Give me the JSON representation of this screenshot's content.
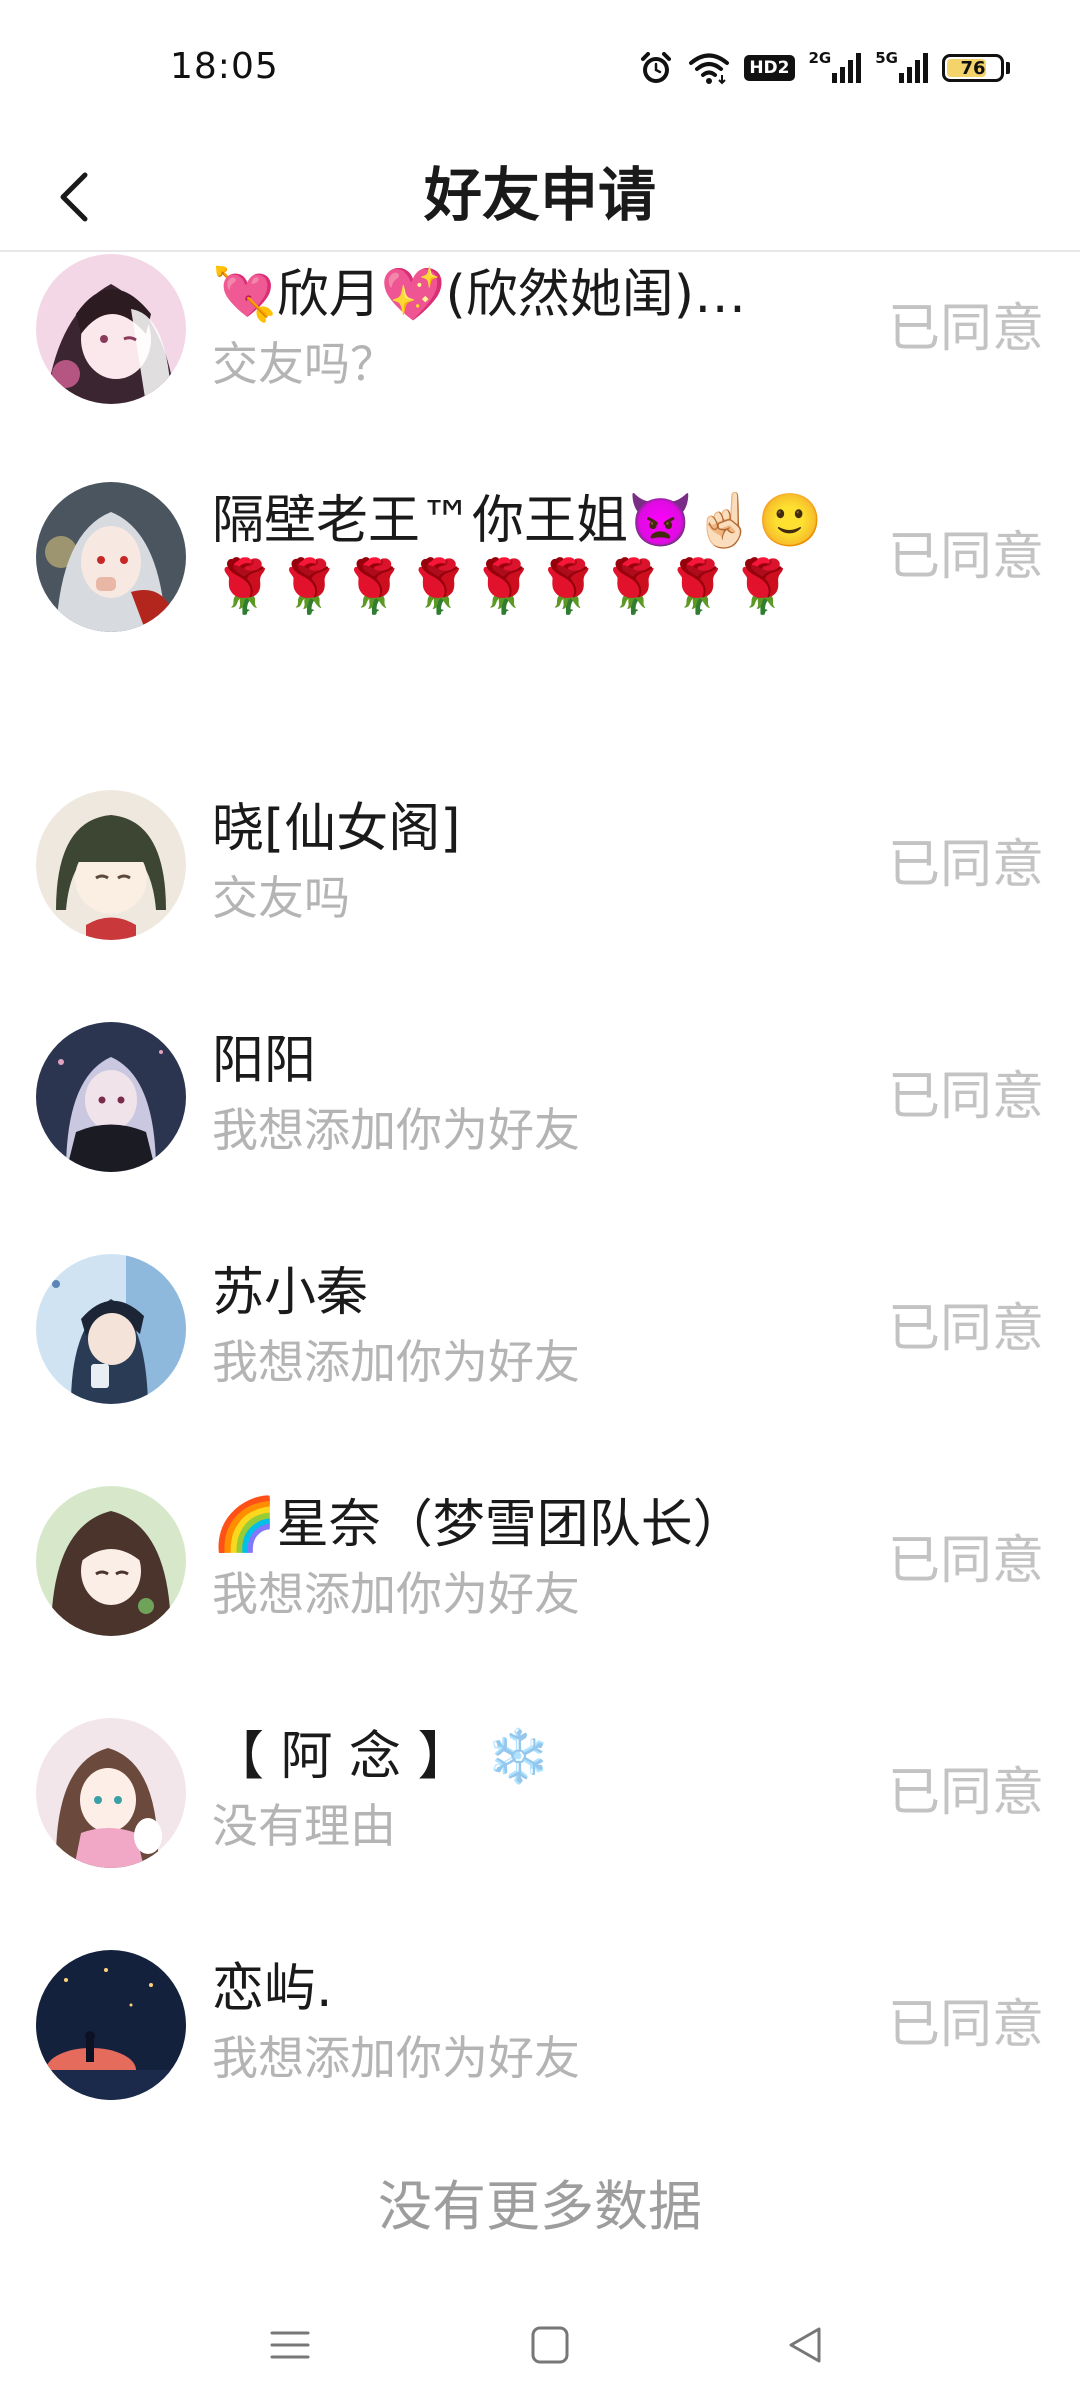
{
  "status_bar": {
    "time": "18:05",
    "hd_label": "HD2",
    "net1_label": "2G",
    "net2_label": "5G",
    "battery_level": 76,
    "battery_text": "76",
    "icons": [
      "alarm-icon",
      "wifi-icon",
      "hd-icon",
      "signal-2g-icon",
      "signal-5g-icon",
      "battery-icon"
    ]
  },
  "header": {
    "title": "好友申请",
    "back_icon": "chevron-left-icon"
  },
  "requests": [
    {
      "name": "💘欣月💖(欣然她闺)…",
      "message": "交友吗？",
      "status": "已同意"
    },
    {
      "name": "隔壁老王™你王姐👿☝🏻🙂🌹🌹🌹🌹🌹🌹🌹🌹🌹",
      "message": "",
      "status": "已同意"
    },
    {
      "name": "晓[仙女阁]",
      "message": "交友吗",
      "status": "已同意"
    },
    {
      "name": "阳阳",
      "message": "我想添加你为好友",
      "status": "已同意"
    },
    {
      "name": "苏小秦",
      "message": "我想添加你为好友",
      "status": "已同意"
    },
    {
      "name": "🌈星奈（梦雪团队长）",
      "message": "我想添加你为好友",
      "status": "已同意"
    },
    {
      "name": "【 阿 念 】 ❄️",
      "message": "没有理由",
      "status": "已同意"
    },
    {
      "name": "恋屿.",
      "message": "我想添加你为好友",
      "status": "已同意"
    }
  ],
  "footer": {
    "no_more_text": "没有更多数据"
  },
  "nav_bar": {
    "icons": [
      "menu-icon",
      "home-square-icon",
      "back-triangle-icon"
    ]
  },
  "colors": {
    "status_agreed": "#c3c3c3",
    "message_text": "#b4b4b4",
    "divider": "#e7e7e7",
    "battery_fill": "#f4d36a"
  }
}
